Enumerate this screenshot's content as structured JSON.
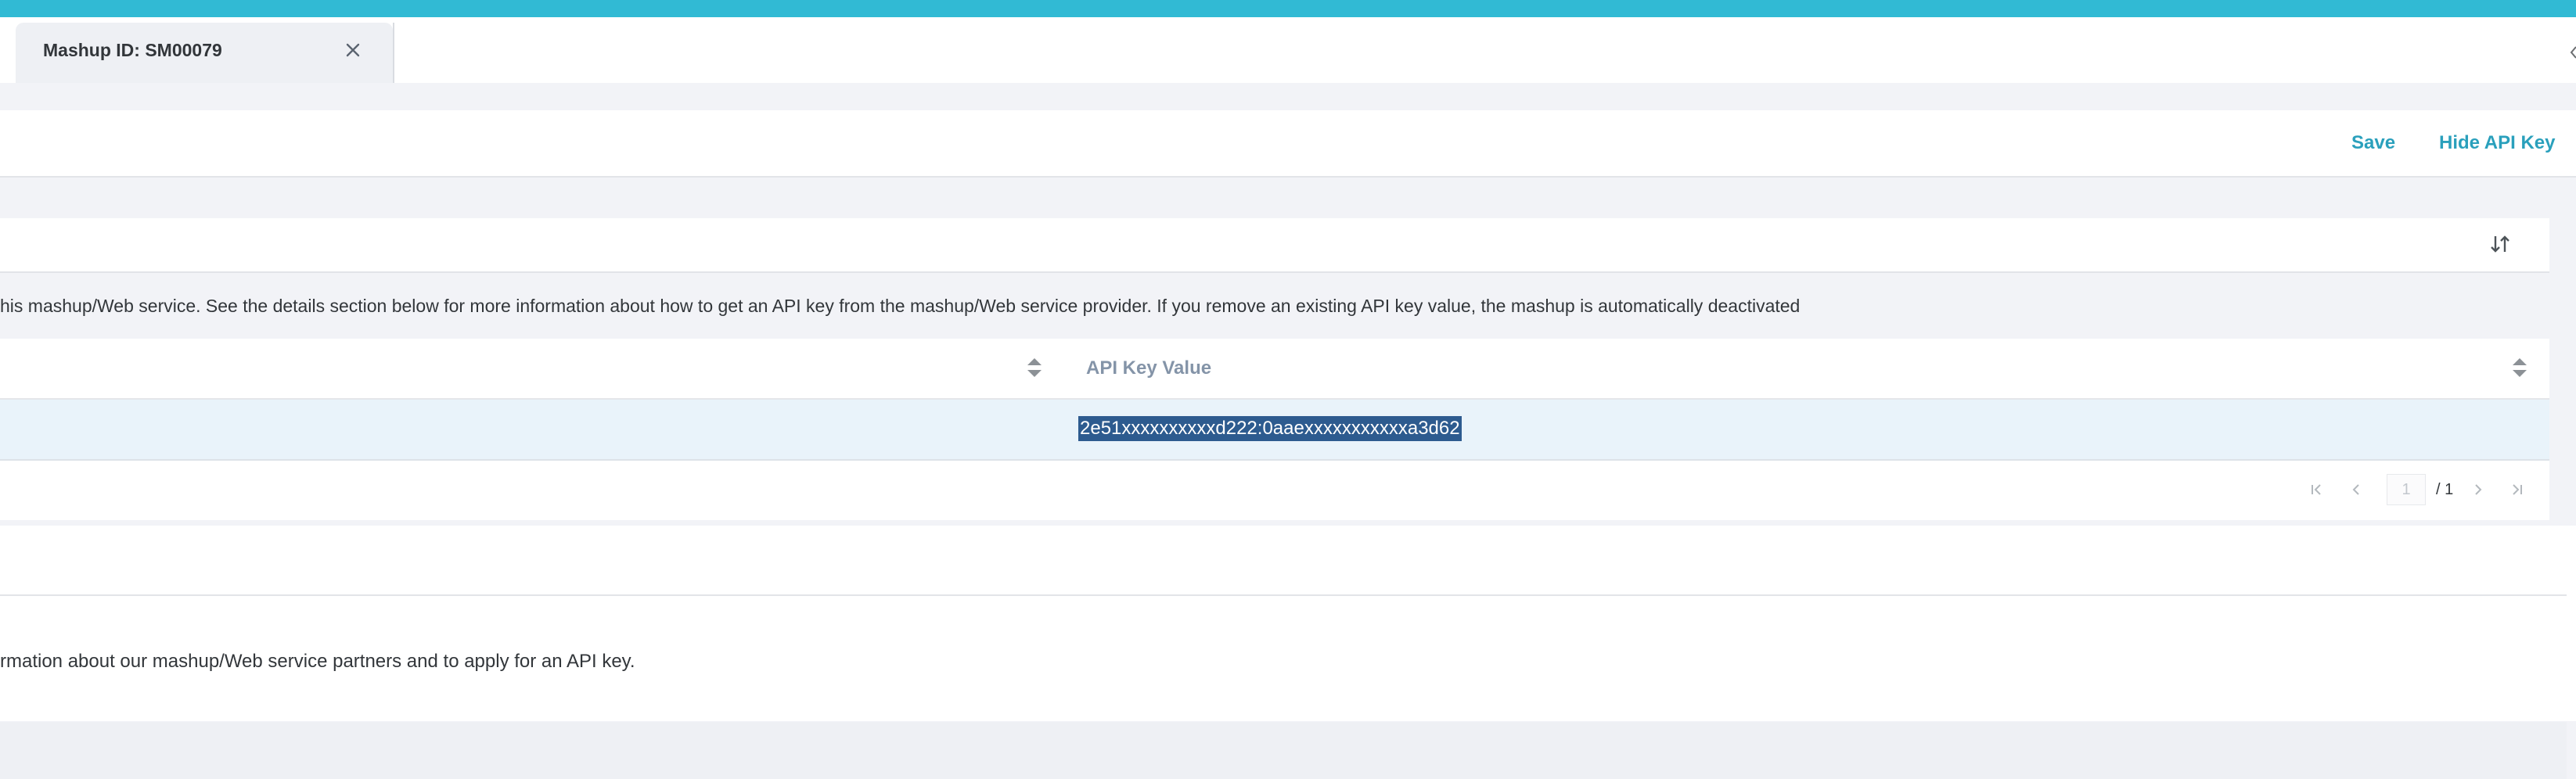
{
  "tab": {
    "title": "Mashup ID: SM00079",
    "close_icon": "close-icon"
  },
  "toolbar": {
    "save_label": "Save",
    "hide_api_key_label": "Hide API Key"
  },
  "panel": {
    "sort_icon": "sort-icon",
    "info_text": "his mashup/Web service. See the details section below for more information about how to get an API key from the mashup/Web service provider. If you remove an existing API key value, the mashup is automatically deactivated"
  },
  "table": {
    "columns": [
      "",
      "API Key Value"
    ],
    "rows": [
      {
        "api_key_value": "2e51xxxxxxxxxxd222:0aaexxxxxxxxxxxa3d62"
      }
    ]
  },
  "pagination": {
    "current_page": "1",
    "total": "/ 1"
  },
  "details": {
    "text": "rmation about our mashup/Web service partners and to apply for an API key."
  },
  "colors": {
    "accent": "#31bad4",
    "link": "#2aa0bc",
    "selection": "#2d5b8f",
    "row_highlight": "#e9f3fa"
  }
}
